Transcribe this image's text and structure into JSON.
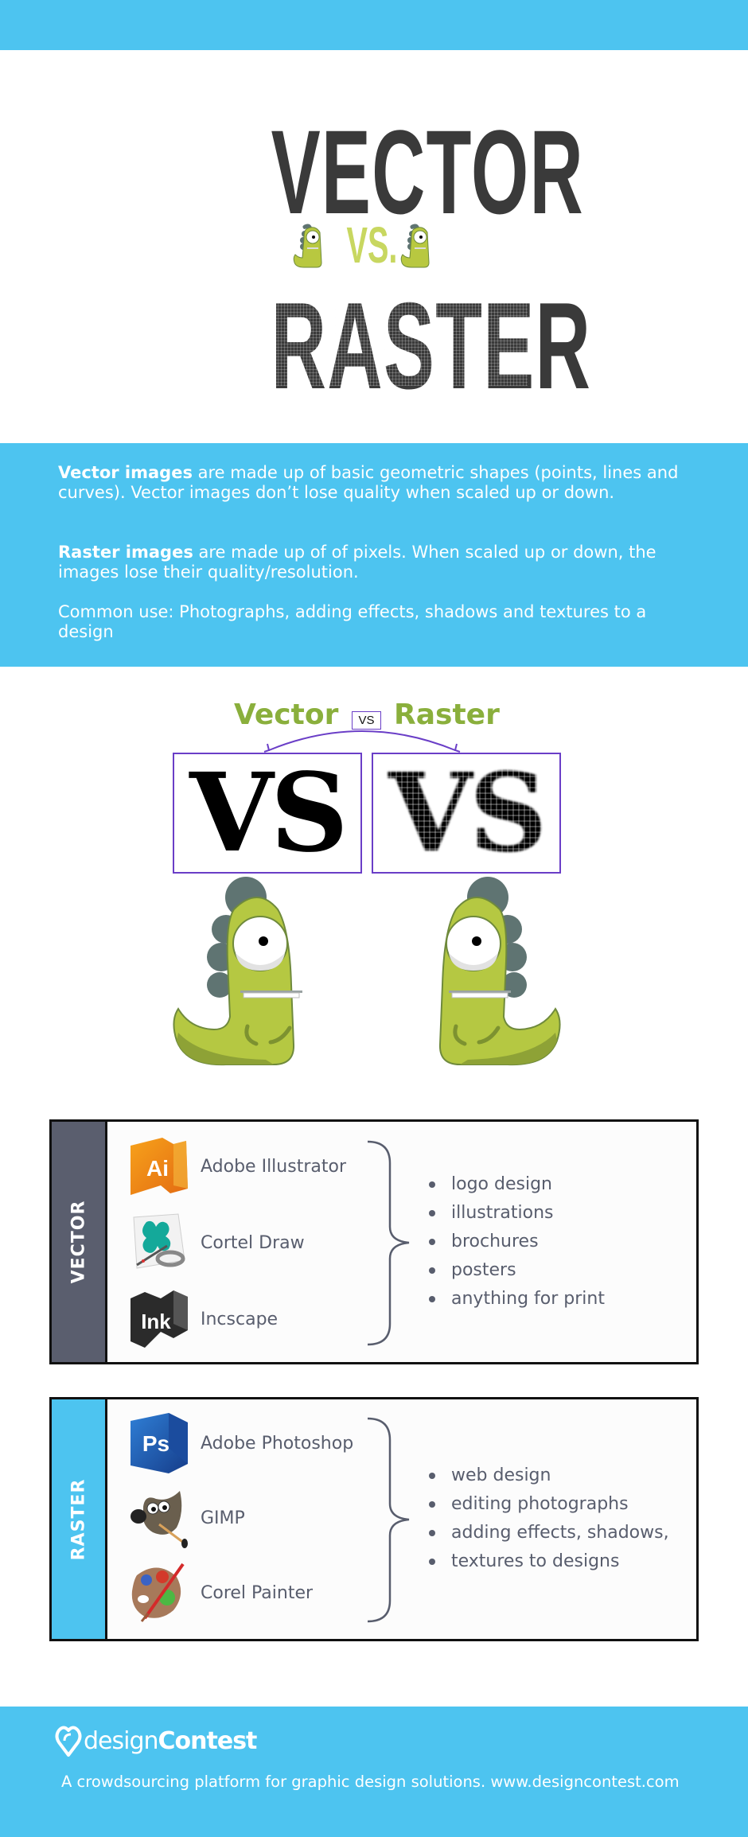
{
  "header": {
    "title_top": "VECTOR",
    "title_vs": "VS.",
    "title_bottom": "RASTER"
  },
  "info": {
    "vector_term": "Vector images",
    "vector_desc": " are made up of basic geometric shapes (points, lines and curves). Vector images don’t lose quality when scaled up or down.",
    "raster_term": "Raster images",
    "raster_desc": " are made up of of pixels. When scaled up or down, the images lose their quality/resolution.",
    "common_use": "Common use: Photographs, adding effects, shadows and textures to a design"
  },
  "comparison": {
    "left_label": "Vector",
    "vs_label": "VS",
    "right_label": "Raster",
    "left_sample": "VS",
    "right_sample": "VS",
    "accent_color": "#8aaf3c",
    "frame_color": "#6a3ec7"
  },
  "panels": {
    "vector": {
      "label": "VECTOR",
      "color": "#5a5e6e",
      "tools": [
        {
          "name": "Adobe Illustrator",
          "icon": "adobe-illustrator-icon"
        },
        {
          "name": "Cortel Draw",
          "icon": "corel-draw-icon"
        },
        {
          "name": "Incscape",
          "icon": "inkscape-icon"
        }
      ],
      "uses": [
        "logo design",
        "illustrations",
        "brochures",
        "posters",
        "anything for print"
      ]
    },
    "raster": {
      "label": "RASTER",
      "color": "#4dc4f0",
      "tools": [
        {
          "name": "Adobe Photoshop",
          "icon": "adobe-photoshop-icon"
        },
        {
          "name": "GIMP",
          "icon": "gimp-icon"
        },
        {
          "name": "Corel Painter",
          "icon": "corel-painter-icon"
        }
      ],
      "uses": [
        "web design",
        "editing photographs",
        "adding effects, shadows,",
        "textures to designs"
      ]
    }
  },
  "footer": {
    "logo_light": "design",
    "logo_bold": "Contest",
    "tagline": "A crowdsourcing platform for graphic design solutions. www.designcontest.com"
  }
}
